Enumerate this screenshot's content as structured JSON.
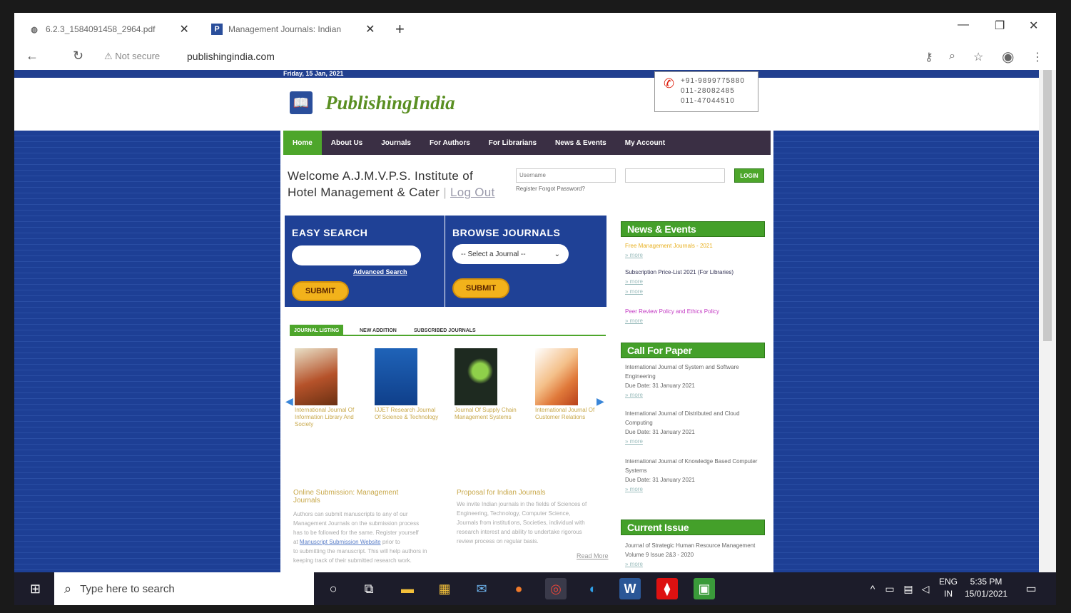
{
  "browser": {
    "tabs": [
      {
        "title": "6.2.3_1584091458_2964.pdf",
        "close": "✕"
      },
      {
        "title": "Management Journals: Indian",
        "close": "✕"
      }
    ],
    "new_tab": "+",
    "url": "publishingindia.com",
    "security": "Not secure"
  },
  "page": {
    "date": "Friday, 15 Jan, 2021",
    "brand": "PublishingIndia",
    "phones": [
      "+91-9899775880",
      "011-28082485",
      "011-47044510"
    ],
    "menu": [
      "Home",
      "About Us",
      "Journals",
      "For Authors",
      "For Librarians",
      "News & Events",
      "My Account"
    ],
    "welcome": "Welcome A.J.M.V.P.S. Institute of Hotel Management & Cater",
    "logout": "Log Out",
    "login": {
      "username_placeholder": "Username",
      "button": "LOGIN",
      "links": "Register   Forgot Password?"
    },
    "easy_search": {
      "title": "EASY SEARCH",
      "advanced": "Advanced Search",
      "submit": "SUBMIT"
    },
    "browse": {
      "title": "BROWSE JOURNALS",
      "select": "-- Select a Journal --",
      "submit": "SUBMIT"
    },
    "journal_tabs": [
      "JOURNAL LISTING",
      "NEW ADDITION",
      "SUBSCRIBED JOURNALS"
    ],
    "books": [
      {
        "title": "International Journal Of Information Library And Society",
        "color": "#b5522a"
      },
      {
        "title": "IJJET Research Journal Of Science & Technology",
        "color": "#1f63b8"
      },
      {
        "title": "Journal Of Supply Chain Management Systems",
        "color": "#1e2a20"
      },
      {
        "title": "International Journal Of Customer Relations",
        "color": "#e0793a"
      }
    ],
    "online": {
      "title": "Online Submission: Management Journals",
      "text": [
        "Authors can submit manuscripts to any of our",
        "Management Journals on the submission process",
        "has to be followed for the same. Register yourself",
        "to submitting the manuscript. This will help authors in",
        "keeping track of their submitted research work."
      ],
      "link": "Manuscript Submission Website"
    },
    "proposal": {
      "title": "Proposal for Indian Journals",
      "text": [
        "We invite Indian journals in the fields of Sciences of",
        "Engineering, Technology, Computer Science,",
        "Journals from institutions, Societies, individual with",
        "research interest and ability to undertake rigorous",
        "review process on regular basis."
      ],
      "readmore": "Read More"
    },
    "news": {
      "title": "News & Events",
      "items": [
        {
          "text": "Free Management Journals - 2021",
          "more": "» more"
        },
        {
          "text": "Subscription Price-List 2021 (For Libraries)",
          "more": "» more"
        },
        {
          "text": "",
          "more": "» more"
        },
        {
          "text": "Peer Review Policy and Ethics Policy",
          "more": "» more"
        }
      ]
    },
    "cfp": {
      "title": "Call For Paper",
      "items": [
        {
          "name": "International Journal of System and Software Engineering",
          "due": "Due Date: 31 January 2021",
          "more": "» more"
        },
        {
          "name": "International Journal of Distributed and Cloud Computing",
          "due": "Due Date: 31 January 2021",
          "more": "» more"
        },
        {
          "name": "International Journal of Knowledge Based Computer Systems",
          "due": "Due Date: 31 January 2021",
          "more": "» more"
        }
      ]
    },
    "current": {
      "title": "Current Issue",
      "text": "Journal of Strategic Human Resource Management Volume 9 Issue 2&3 - 2020",
      "more": "» more"
    }
  },
  "taskbar": {
    "search": "Type here to search",
    "lang": "ENG",
    "region": "IN",
    "time": "5:35 PM",
    "date": "15/01/2021"
  },
  "colors": {
    "brand_blue": "#1f4196",
    "menu_dark": "#3a2f44",
    "accent_green": "#44a02a",
    "button_yellow": "#f2b21b"
  }
}
